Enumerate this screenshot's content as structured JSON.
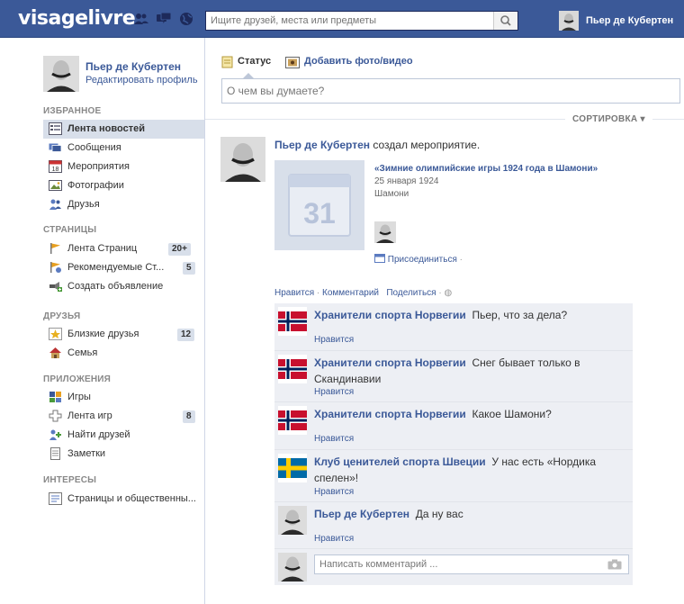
{
  "topbar": {
    "logo": "visagelivre",
    "search_placeholder": "Ищите друзей, места или предметы",
    "user_name": "Пьер де Кубертен"
  },
  "sidebar": {
    "profile_name": "Пьер де Кубертен",
    "edit_profile": "Редактировать профиль",
    "sections": [
      {
        "title": "ИЗБРАННОЕ",
        "items": [
          {
            "label": "Лента новостей",
            "icon": "news-feed-icon",
            "selected": true
          },
          {
            "label": "Сообщения",
            "icon": "messages-icon"
          },
          {
            "label": "Мероприятия",
            "icon": "calendar-icon",
            "icon_text": "18"
          },
          {
            "label": "Фотографии",
            "icon": "photos-icon"
          },
          {
            "label": "Друзья",
            "icon": "friends-icon"
          }
        ]
      },
      {
        "title": "СТРАНИЦЫ",
        "items": [
          {
            "label": "Лента Страниц",
            "icon": "pages-feed-icon",
            "badge": "20+"
          },
          {
            "label": "Рекомендуемые Ст...",
            "icon": "recommended-pages-icon",
            "badge": "5"
          },
          {
            "label": "Создать объявление",
            "icon": "create-ad-icon"
          }
        ]
      },
      {
        "title": "ДРУЗЬЯ",
        "items": [
          {
            "label": "Близкие друзья",
            "icon": "star-icon",
            "badge": "12"
          },
          {
            "label": "Семья",
            "icon": "family-home-icon"
          }
        ]
      },
      {
        "title": "ПРИЛОЖЕНИЯ",
        "items": [
          {
            "label": "Игры",
            "icon": "games-icon"
          },
          {
            "label": "Лента игр",
            "icon": "games-feed-icon",
            "badge": "8"
          },
          {
            "label": "Найти друзей",
            "icon": "find-friends-icon"
          },
          {
            "label": "Заметки",
            "icon": "notes-icon"
          }
        ]
      },
      {
        "title": "ИНТЕРЕСЫ",
        "items": [
          {
            "label": "Страницы и общественны...",
            "icon": "interests-pages-icon"
          }
        ]
      }
    ]
  },
  "composer": {
    "status_tab": "Статус",
    "photo_tab": "Добавить фото/видео",
    "placeholder": "О чем вы думаете?"
  },
  "sort_label": "СОРТИРОВКА",
  "story": {
    "actor": "Пьер де Кубертен",
    "verb": "создал мероприятие.",
    "event": {
      "calendar_day": "31",
      "title": "«Зимние олимпийские игры 1924 года в Шамони»",
      "date": "25 января 1924",
      "place": "Шамони",
      "join": "Присоединиться"
    },
    "actions": {
      "like": "Нравится",
      "comment": "Комментарий",
      "share": "Поделиться"
    }
  },
  "comments": [
    {
      "author": "Хранители спорта Норвегии",
      "text": "Пьер, что за дела?",
      "like": "Нравится",
      "flag": "norway"
    },
    {
      "author": "Хранители спорта Норвегии",
      "text": "Снег бывает только в Скандинавии",
      "like": "Нравится",
      "flag": "norway"
    },
    {
      "author": "Хранители спорта Норвегии",
      "text": "Какое Шамони?",
      "like": "Нравится",
      "flag": "norway"
    },
    {
      "author": "Клуб ценителей спорта Швеции",
      "text": "У нас есть «Нордика спелен»!",
      "like": "Нравится",
      "flag": "sweden"
    },
    {
      "author": "Пьер де Кубертен",
      "text": "Да ну вас",
      "like": "Нравится",
      "flag": "none"
    }
  ],
  "comment_placeholder": "Написать комментарий ...",
  "colors": {
    "brand": "#3b5998",
    "comment_bg": "#edeff4",
    "badge_bg": "#d8dfea"
  }
}
